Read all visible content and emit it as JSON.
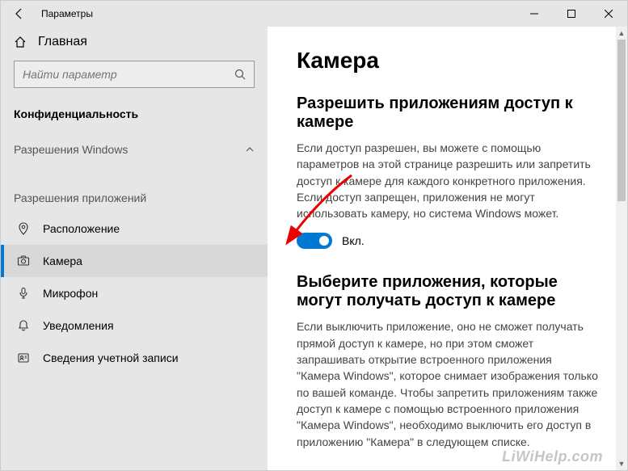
{
  "window": {
    "title": "Параметры"
  },
  "sidebar": {
    "home": "Главная",
    "search_placeholder": "Найти параметр",
    "active_section": "Конфиденциальность",
    "group1": "Разрешения Windows",
    "group2": "Разрешения приложений",
    "items": [
      {
        "label": "Расположение"
      },
      {
        "label": "Камера"
      },
      {
        "label": "Микрофон"
      },
      {
        "label": "Уведомления"
      },
      {
        "label": "Сведения учетной записи"
      }
    ]
  },
  "main": {
    "heading": "Камера",
    "section1_title": "Разрешить приложениям доступ к камере",
    "section1_body": "Если доступ разрешен, вы можете с помощью параметров на этой странице разрешить или запретить доступ к камере для каждого конкретного приложения. Если доступ запрещен, приложения не могут использовать камеру, но система Windows может.",
    "toggle_on_label": "Вкл.",
    "section2_title": "Выберите приложения, которые могут получать доступ к камере",
    "section2_body": "Если выключить приложение, оно не сможет получать прямой доступ к камере, но при этом сможет запрашивать открытие встроенного приложения \"Камера Windows\", которое снимает изображения только по вашей команде. Чтобы запретить приложениям также доступ к камере с помощью встроенного приложения \"Камера Windows\", необходимо выключить его доступ в приложению \"Камера\" в следующем списке."
  },
  "watermark": "LiWiHelp.com"
}
